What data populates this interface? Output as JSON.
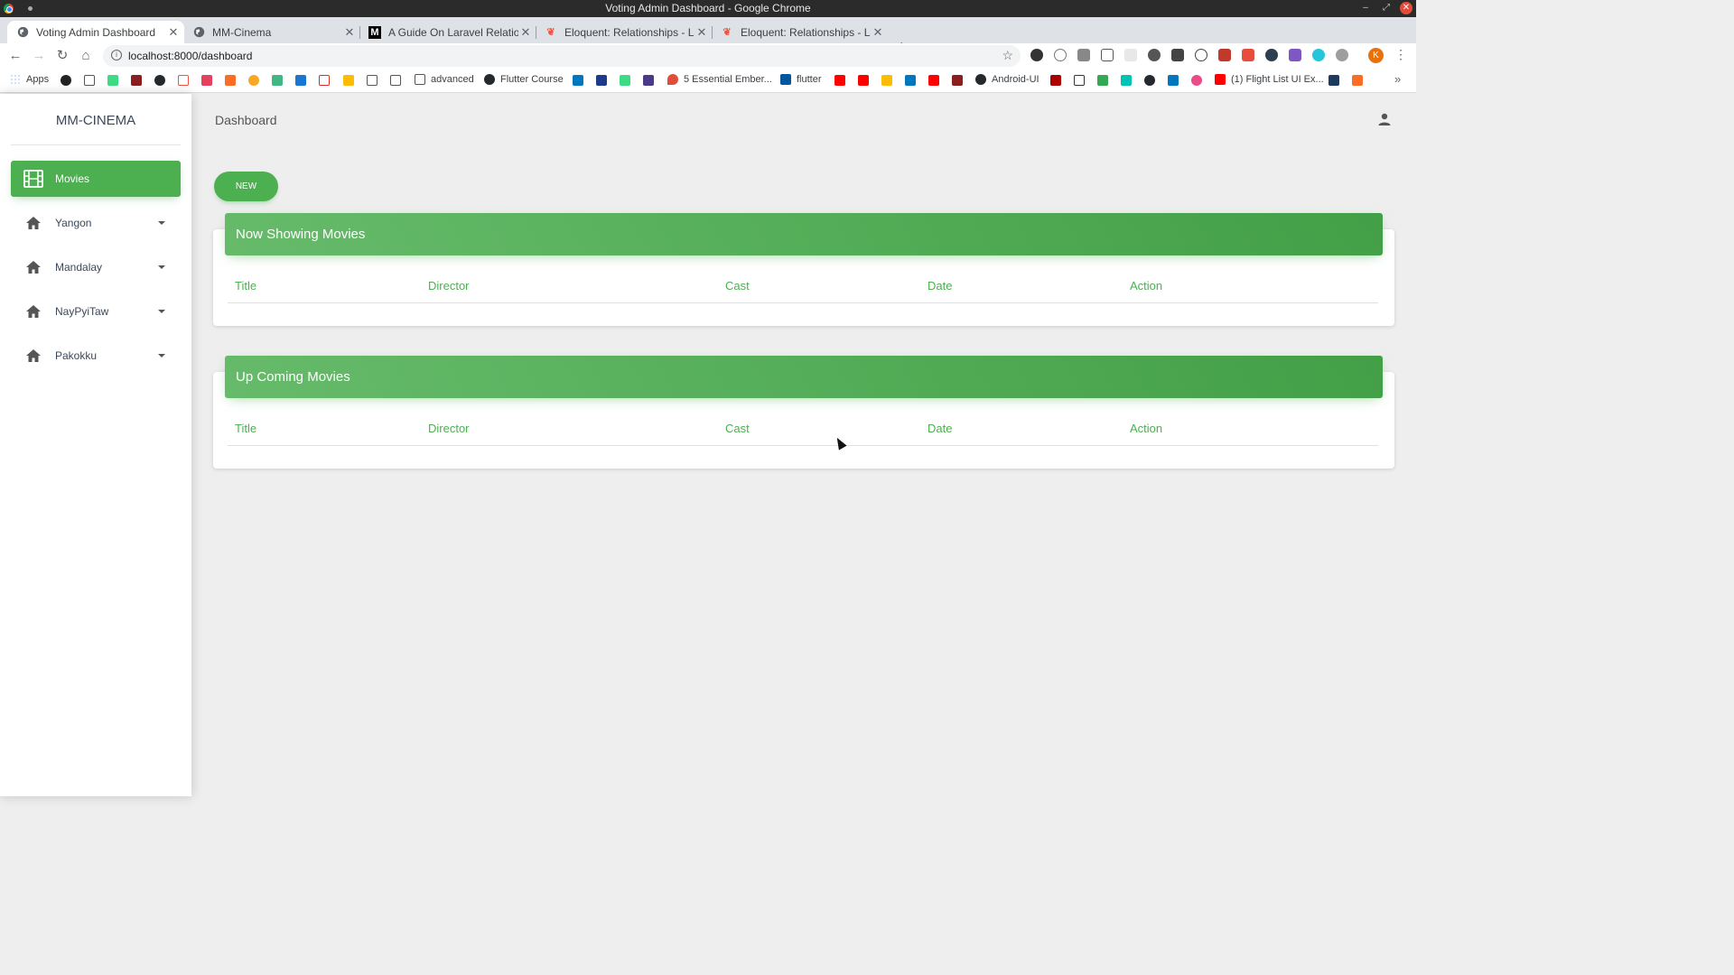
{
  "window": {
    "title": "Voting Admin Dashboard - Google Chrome"
  },
  "tabs": [
    {
      "label": "Voting Admin Dashboard",
      "icon": "globe-icon",
      "active": true
    },
    {
      "label": "MM-Cinema",
      "icon": "globe-icon",
      "active": false
    },
    {
      "label": "A Guide On Laravel Relationshi",
      "icon": "medium-icon",
      "active": false
    },
    {
      "label": "Eloquent: Relationships - Larav",
      "icon": "laravel-icon",
      "active": false
    },
    {
      "label": "Eloquent: Relationships - Larav",
      "icon": "laravel-icon",
      "active": false
    }
  ],
  "toolbar": {
    "url": "localhost:8000/dashboard",
    "profile_initial": "K"
  },
  "bookmarks": {
    "apps": "Apps",
    "advanced": "advanced",
    "flutter_course": "Flutter Course",
    "ember": "5 Essential Ember...",
    "flutter": "flutter",
    "android_ui": "Android-UI",
    "flight_list": "(1) Flight List UI Ex..."
  },
  "sidebar": {
    "brand": "MM-CINEMA",
    "items": [
      {
        "label": "Movies",
        "icon": "film-icon",
        "active": true
      },
      {
        "label": "Yangon",
        "icon": "home-icon",
        "active": false
      },
      {
        "label": "Mandalay",
        "icon": "home-icon",
        "active": false
      },
      {
        "label": "NayPyiTaw",
        "icon": "home-icon",
        "active": false
      },
      {
        "label": "Pakokku",
        "icon": "home-icon",
        "active": false
      }
    ]
  },
  "main": {
    "page_title": "Dashboard",
    "new_button": "NEW",
    "now_showing": {
      "title": "Now Showing Movies",
      "columns": [
        "Title",
        "Director",
        "Cast",
        "Date",
        "Action"
      ]
    },
    "upcoming": {
      "title": "Up Coming Movies",
      "columns": [
        "Title",
        "Director",
        "Cast",
        "Date",
        "Action"
      ]
    }
  },
  "colors": {
    "accent": "#4caf50",
    "background": "#eeeeee",
    "sidebar": "#ffffff"
  }
}
